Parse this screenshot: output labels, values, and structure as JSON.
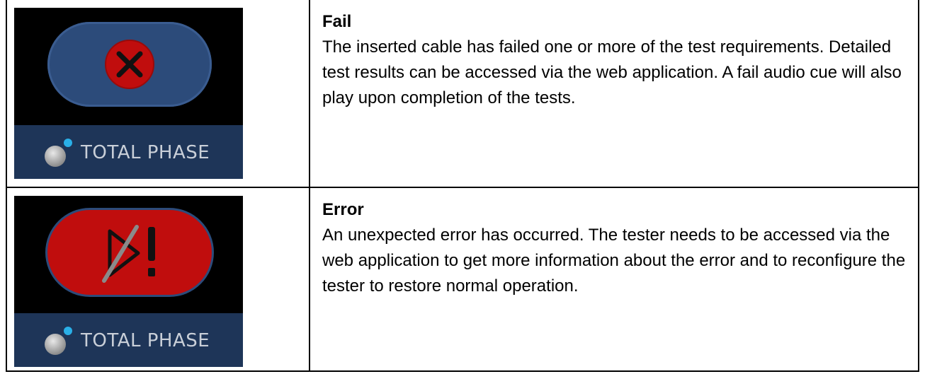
{
  "rows": [
    {
      "status_icon": "fail-x-icon",
      "pill_color": "#2c4b7a",
      "logo_text": "TOTAL PHASE",
      "title": "Fail",
      "body": "The inserted cable has failed one or more of the test requirements. Detailed test results can be accessed via the web application. A fail audio cue will also play upon completion of the tests."
    },
    {
      "status_icon": "error-exclamation-icon",
      "pill_color": "#c00d0d",
      "logo_text": "TOTAL PHASE",
      "title": "Error",
      "body": "An unexpected error has occurred. The tester needs to be accessed via the web application to get more information about the error and to reconfigure the tester to restore normal operation."
    }
  ]
}
